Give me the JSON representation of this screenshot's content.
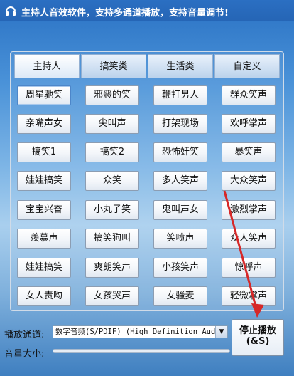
{
  "window": {
    "title": "主持人音效软件，支持多通道播放，支持音量调节!"
  },
  "tabs": [
    {
      "label": "主持人",
      "active": true
    },
    {
      "label": "搞笑类",
      "active": false
    },
    {
      "label": "生活类",
      "active": false
    },
    {
      "label": "自定义",
      "active": false
    }
  ],
  "sounds": [
    "周星驰笑",
    "邪恶的笑",
    "鞭打男人",
    "群众笑声",
    "亲嘴声女",
    "尖叫声",
    "打架现场",
    "欢呼掌声",
    "搞笑1",
    "搞笑2",
    "恐怖奸笑",
    "暴笑声",
    "娃娃搞笑",
    "众笑",
    "多人笑声",
    "大众笑声",
    "宝宝兴奋",
    "小丸子笑",
    "鬼叫声女",
    "激烈掌声",
    "羡慕声",
    "搞笑狗叫",
    "笑喷声",
    "众人笑声",
    "娃娃搞笑",
    "爽朗笑声",
    "小孩笑声",
    "惊呼声",
    "女人责吻",
    "女孩哭声",
    "女骚麦",
    "轻微掌声"
  ],
  "controls": {
    "channel_label": "播放通道:",
    "channel_value": "数字音频(S/PDIF) (High Definition Aud",
    "volume_label": "音量大小:",
    "volume_level": 0.0,
    "stop_line1": "停止播放",
    "stop_line2": "(&S)"
  },
  "colors": {
    "accent": "#2565b5",
    "arrow": "#d62828"
  }
}
